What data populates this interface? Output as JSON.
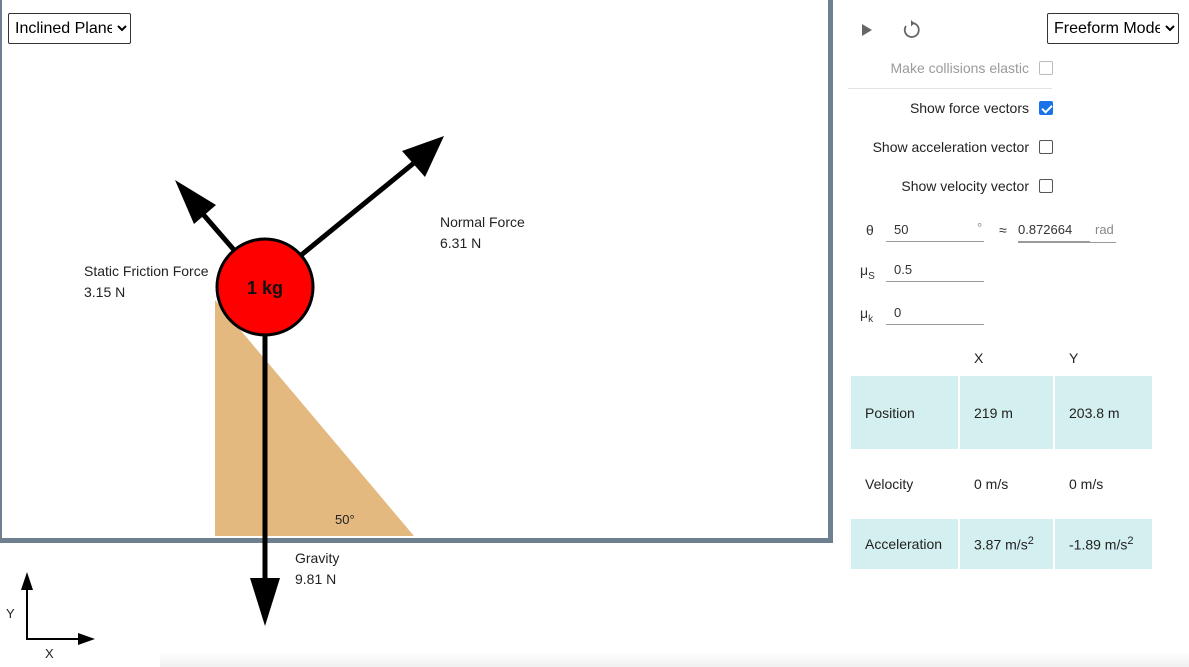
{
  "scene": {
    "selected_scene": "Inclined Plane",
    "mass_label": "1 kg",
    "angle_label": "50°",
    "forces": {
      "normal": {
        "name": "Normal Force",
        "value": "6.31 N"
      },
      "friction": {
        "name": "Static Friction Force",
        "value": "3.15 N"
      },
      "gravity": {
        "name": "Gravity",
        "value": "9.81 N"
      }
    },
    "axes": {
      "x_label": "X",
      "y_label": "Y"
    },
    "colors": {
      "ball": "#ff0000",
      "ramp": "#e3b97f",
      "frame": "#6e7f90"
    }
  },
  "toolbar": {
    "play_icon": "play-icon",
    "reset_icon": "reset-icon",
    "mode": "Freeform Mode"
  },
  "options": {
    "elastic": {
      "label": "Make collisions elastic",
      "checked": false,
      "disabled": true
    },
    "force_vectors": {
      "label": "Show force vectors",
      "checked": true
    },
    "acceleration_vector": {
      "label": "Show acceleration vector",
      "checked": false
    },
    "velocity_vector": {
      "label": "Show velocity vector",
      "checked": false
    }
  },
  "params": {
    "theta_symbol": "θ",
    "theta_deg": "50",
    "degree_unit": "°",
    "approx": "≈",
    "theta_rad": "0.872664",
    "rad_unit": "rad",
    "mu_s_symbol": "μ",
    "mu_s_sub": "S",
    "mu_s": "0.5",
    "mu_k_symbol": "μ",
    "mu_k_sub": "k",
    "mu_k": "0"
  },
  "kinematics": {
    "headers": [
      "X",
      "Y"
    ],
    "position": {
      "label": "Position",
      "x": "219 m",
      "y": "203.8 m"
    },
    "velocity": {
      "label": "Velocity",
      "x": "0 m/s",
      "y": "0 m/s"
    },
    "acceleration": {
      "label": "Acceleration",
      "x": "3.87 m/s",
      "y": "-1.89 m/s",
      "unit_exp": "2"
    }
  }
}
